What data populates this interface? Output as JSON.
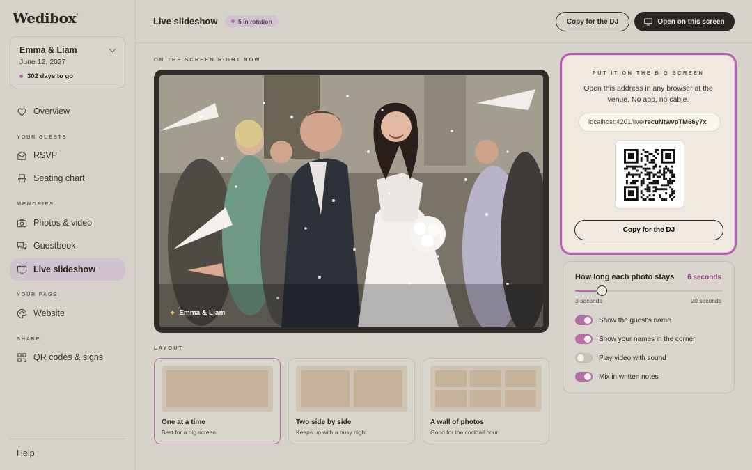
{
  "brand": {
    "logo": "Wedibox"
  },
  "couple": {
    "names": "Emma & Liam",
    "date": "June 12, 2027",
    "countdown": "302 days to go"
  },
  "nav": {
    "overview": "Overview",
    "section_guests": "YOUR GUESTS",
    "rsvp": "RSVP",
    "seating": "Seating chart",
    "section_memories": "MEMORIES",
    "photos": "Photos & video",
    "guestbook": "Guestbook",
    "slideshow": "Live slideshow",
    "section_page": "YOUR PAGE",
    "website": "Website",
    "section_share": "SHARE",
    "qr": "QR codes & signs",
    "help": "Help"
  },
  "header": {
    "title": "Live slideshow",
    "rotation_badge": "5 in rotation",
    "copy_dj": "Copy for the DJ",
    "open_screen": "Open on this screen"
  },
  "main": {
    "now_label": "ON THE SCREEN RIGHT NOW",
    "photo_caption": "Emma & Liam",
    "layout_label": "LAYOUT",
    "layouts": [
      {
        "title": "One at a time",
        "subtitle": "Best for a big screen"
      },
      {
        "title": "Two side by side",
        "subtitle": "Keeps up with a busy night"
      },
      {
        "title": "A wall of photos",
        "subtitle": "Good for the cocktail hour"
      }
    ]
  },
  "bigscreen": {
    "eyebrow": "PUT IT ON THE BIG SCREEN",
    "description": "Open this address in any browser at the venue. No app, no cable.",
    "url_prefix": "localhost:4201/live/",
    "url_id": "recuNtwvpTM66y7x",
    "copy_dj": "Copy for the DJ"
  },
  "settings": {
    "duration_label": "How long each photo stays",
    "duration_value": "6 seconds",
    "slider_min": "3 seconds",
    "slider_max": "20 seconds",
    "slider_fraction": 0.18,
    "toggles": [
      {
        "label": "Show the guest's name",
        "on": true
      },
      {
        "label": "Show your names in the corner",
        "on": true
      },
      {
        "label": "Play video with sound",
        "on": false
      },
      {
        "label": "Mix in written notes",
        "on": true
      }
    ]
  },
  "colors": {
    "accent": "#b26fa5",
    "dark": "#2a2622",
    "background": "#d6d2ca"
  }
}
